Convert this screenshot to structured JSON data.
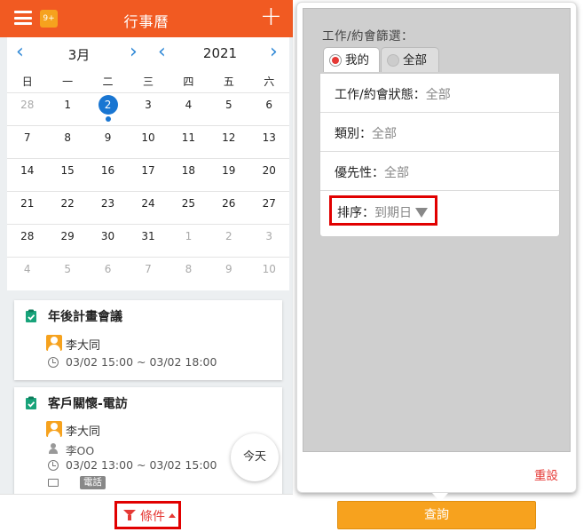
{
  "left_panel": {
    "header": {
      "title": "行事曆",
      "badge": "9+",
      "menu_icon": "hamburger-menu-icon",
      "add_icon": "plus-icon"
    },
    "calendar": {
      "month": "3月",
      "year": "2021",
      "prev_icon": "chevron-left-icon",
      "next_icon": "chevron-right-icon",
      "weekdays": [
        "日",
        "一",
        "二",
        "三",
        "四",
        "五",
        "六"
      ],
      "weeks": [
        [
          "28",
          "1",
          "2",
          "3",
          "4",
          "5",
          "6"
        ],
        [
          "7",
          "8",
          "9",
          "10",
          "11",
          "12",
          "13"
        ],
        [
          "14",
          "15",
          "16",
          "17",
          "18",
          "19",
          "20"
        ],
        [
          "21",
          "22",
          "23",
          "24",
          "25",
          "26",
          "27"
        ],
        [
          "28",
          "29",
          "30",
          "31",
          "1",
          "2",
          "3"
        ],
        [
          "4",
          "5",
          "6",
          "7",
          "8",
          "9",
          "10"
        ]
      ],
      "selected_day": "2",
      "accent_color": "#1976d2"
    },
    "events": [
      {
        "title": "年後計畫會議",
        "owner": "李大同",
        "time": "03/02 15:00 ~ 03/02 18:00"
      },
      {
        "title": "客戶關懷-電訪",
        "owner": "李大同",
        "contact": "李OO",
        "time": "03/02 13:00 ~ 03/02 15:00",
        "tag": "電話"
      }
    ],
    "today_button": "今天",
    "filter_button": "條件"
  },
  "right_panel": {
    "filter_title": "工作/約會篩選：",
    "tabs": [
      {
        "label": "我的",
        "selected": true
      },
      {
        "label": "全部",
        "selected": false
      }
    ],
    "fields": [
      {
        "label": "工作/約會狀態：",
        "value": "全部"
      },
      {
        "label": "類別：",
        "value": "全部"
      },
      {
        "label": "優先性：",
        "value": "全部"
      },
      {
        "label": "排序：",
        "value": "到期日"
      }
    ],
    "reset_label": "重設",
    "query_label": "查詢"
  },
  "colors": {
    "header_bg": "#f15a22",
    "highlight_border": "#e10000",
    "query_button": "#f7a21e"
  }
}
